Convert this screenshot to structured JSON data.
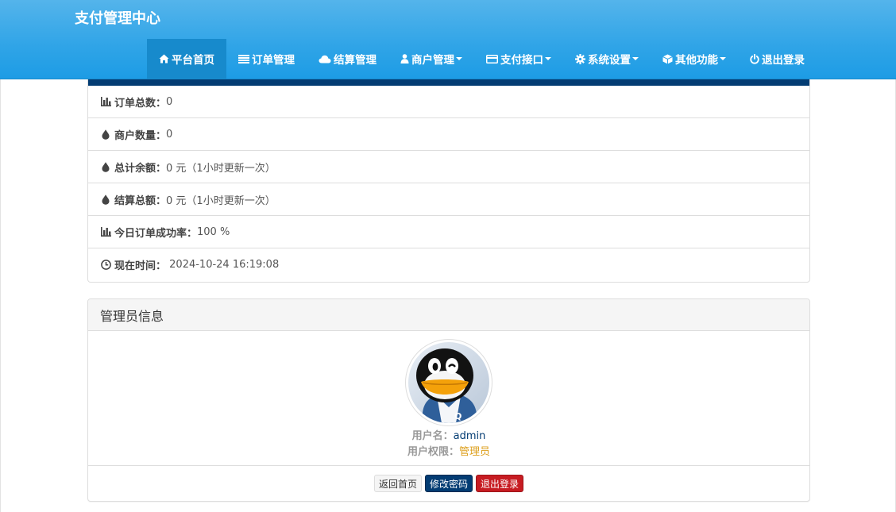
{
  "app": {
    "brand": "支付管理中心"
  },
  "nav": {
    "items": [
      {
        "label": "平台首页",
        "icon": "home-icon",
        "active": true,
        "dropdown": false
      },
      {
        "label": "订单管理",
        "icon": "list-icon",
        "active": false,
        "dropdown": false
      },
      {
        "label": "结算管理",
        "icon": "cloud-icon",
        "active": false,
        "dropdown": false
      },
      {
        "label": "商户管理",
        "icon": "user-icon",
        "active": false,
        "dropdown": true
      },
      {
        "label": "支付接口",
        "icon": "credit-card-icon",
        "active": false,
        "dropdown": true
      },
      {
        "label": "系统设置",
        "icon": "cog-icon",
        "active": false,
        "dropdown": true
      },
      {
        "label": "其他功能",
        "icon": "cube-icon",
        "active": false,
        "dropdown": true
      },
      {
        "label": "退出登录",
        "icon": "power-icon",
        "active": false,
        "dropdown": false
      }
    ]
  },
  "stats": {
    "rows": [
      {
        "icon": "bar-chart-icon",
        "label": "订单总数：",
        "value": "0"
      },
      {
        "icon": "drop-icon",
        "label": "商户数量：",
        "value": "0"
      },
      {
        "icon": "drop-icon",
        "label": "总计余额：",
        "value": "0 元（1小时更新一次）"
      },
      {
        "icon": "drop-icon",
        "label": "结算总额：",
        "value": "0 元（1小时更新一次）"
      },
      {
        "icon": "bar-chart-icon",
        "label": "今日订单成功率：",
        "value": "100 %"
      },
      {
        "icon": "clock-icon",
        "label": "现在时间：",
        "value": " 2024-10-24 16:19:08"
      }
    ]
  },
  "admin": {
    "title": "管理员信息",
    "username_label": "用户名：",
    "username": "admin",
    "role_label": "用户权限：",
    "role": "管理员",
    "buttons": {
      "home": "返回首页",
      "change_password": "修改密码",
      "logout": "退出登录"
    }
  },
  "colors": {
    "navbar": "#2fa4e7",
    "navbar_active": "#178acc",
    "primary_dark": "#033c73",
    "danger": "#c71c22",
    "role": "#dd9f1c"
  }
}
